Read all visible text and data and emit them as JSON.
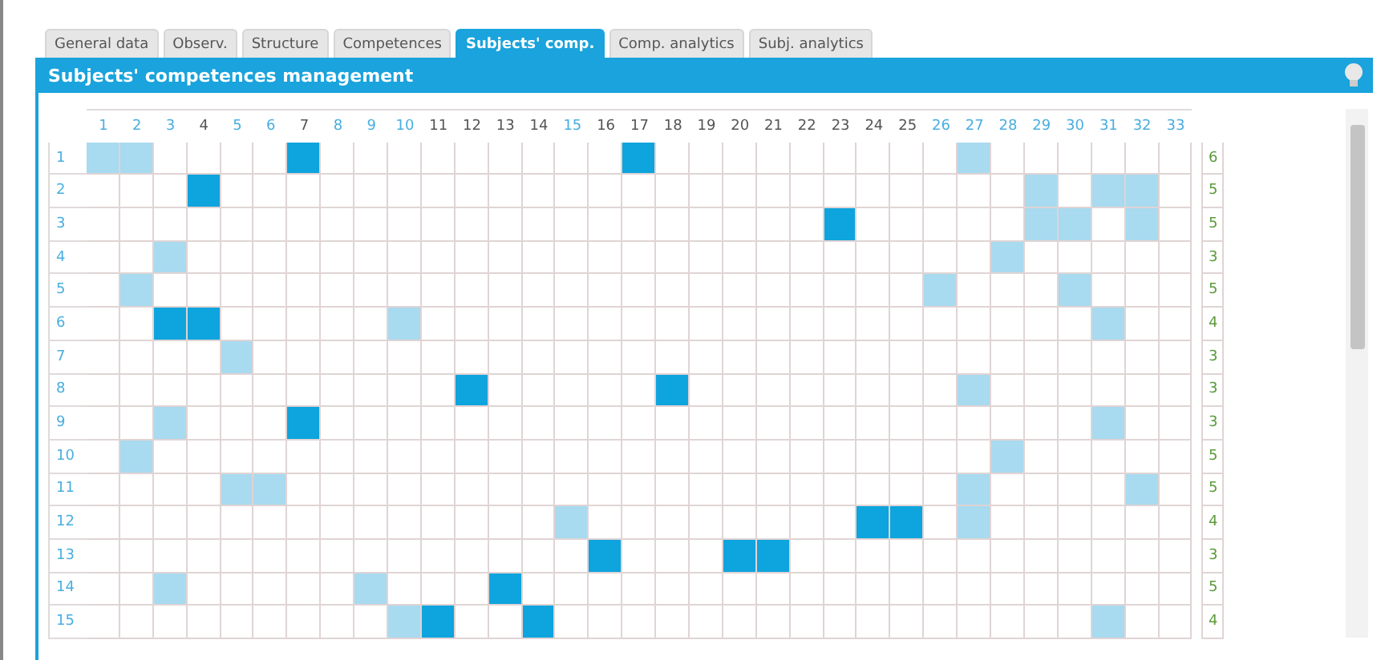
{
  "tabs": [
    {
      "label": "General data",
      "selected": false
    },
    {
      "label": "Observ.",
      "selected": false
    },
    {
      "label": "Structure",
      "selected": false
    },
    {
      "label": "Competences",
      "selected": false
    },
    {
      "label": "Subjects' comp.",
      "selected": true
    },
    {
      "label": "Comp. analytics",
      "selected": false
    },
    {
      "label": "Subj. analytics",
      "selected": false
    }
  ],
  "panel": {
    "title": "Subjects' competences management"
  },
  "columns": [
    {
      "label": "1",
      "highlighted": true
    },
    {
      "label": "2",
      "highlighted": true
    },
    {
      "label": "3",
      "highlighted": true
    },
    {
      "label": "4",
      "highlighted": false
    },
    {
      "label": "5",
      "highlighted": true
    },
    {
      "label": "6",
      "highlighted": true
    },
    {
      "label": "7",
      "highlighted": false
    },
    {
      "label": "8",
      "highlighted": true
    },
    {
      "label": "9",
      "highlighted": true
    },
    {
      "label": "10",
      "highlighted": true
    },
    {
      "label": "11",
      "highlighted": false
    },
    {
      "label": "12",
      "highlighted": false
    },
    {
      "label": "13",
      "highlighted": false
    },
    {
      "label": "14",
      "highlighted": false
    },
    {
      "label": "15",
      "highlighted": true
    },
    {
      "label": "16",
      "highlighted": false
    },
    {
      "label": "17",
      "highlighted": false
    },
    {
      "label": "18",
      "highlighted": false
    },
    {
      "label": "19",
      "highlighted": false
    },
    {
      "label": "20",
      "highlighted": false
    },
    {
      "label": "21",
      "highlighted": false
    },
    {
      "label": "22",
      "highlighted": false
    },
    {
      "label": "23",
      "highlighted": false
    },
    {
      "label": "24",
      "highlighted": false
    },
    {
      "label": "25",
      "highlighted": false
    },
    {
      "label": "26",
      "highlighted": true
    },
    {
      "label": "27",
      "highlighted": true
    },
    {
      "label": "28",
      "highlighted": true
    },
    {
      "label": "29",
      "highlighted": true
    },
    {
      "label": "30",
      "highlighted": true
    },
    {
      "label": "31",
      "highlighted": true
    },
    {
      "label": "32",
      "highlighted": true
    },
    {
      "label": "33",
      "highlighted": true
    }
  ],
  "rows": [
    {
      "label": "1",
      "count": "6",
      "cells": [
        {
          "kind": "light"
        },
        {
          "kind": "light"
        },
        {
          "kind": "none"
        },
        {
          "kind": "none"
        },
        {
          "kind": "none"
        },
        {
          "kind": "none"
        },
        {
          "kind": "dark"
        },
        {
          "kind": "none"
        },
        {
          "kind": "none"
        },
        {
          "kind": "none"
        },
        {
          "kind": "none"
        },
        {
          "kind": "none"
        },
        {
          "kind": "none"
        },
        {
          "kind": "none"
        },
        {
          "kind": "none"
        },
        {
          "kind": "none"
        },
        {
          "kind": "dark"
        },
        {
          "kind": "none"
        },
        {
          "kind": "none"
        },
        {
          "kind": "none"
        },
        {
          "kind": "none"
        },
        {
          "kind": "none"
        },
        {
          "kind": "none"
        },
        {
          "kind": "none"
        },
        {
          "kind": "none"
        },
        {
          "kind": "none"
        },
        {
          "kind": "light"
        },
        {
          "kind": "none"
        },
        {
          "kind": "none"
        },
        {
          "kind": "none"
        },
        {
          "kind": "none"
        },
        {
          "kind": "none"
        },
        {
          "kind": "none"
        }
      ]
    },
    {
      "label": "2",
      "count": "5",
      "cells": [
        {
          "kind": "none"
        },
        {
          "kind": "none"
        },
        {
          "kind": "none"
        },
        {
          "kind": "dark"
        },
        {
          "kind": "none"
        },
        {
          "kind": "none"
        },
        {
          "kind": "none"
        },
        {
          "kind": "none"
        },
        {
          "kind": "none"
        },
        {
          "kind": "none"
        },
        {
          "kind": "none"
        },
        {
          "kind": "none"
        },
        {
          "kind": "none"
        },
        {
          "kind": "none"
        },
        {
          "kind": "none"
        },
        {
          "kind": "none"
        },
        {
          "kind": "none"
        },
        {
          "kind": "none"
        },
        {
          "kind": "none"
        },
        {
          "kind": "none"
        },
        {
          "kind": "none"
        },
        {
          "kind": "none"
        },
        {
          "kind": "none"
        },
        {
          "kind": "none"
        },
        {
          "kind": "none"
        },
        {
          "kind": "none"
        },
        {
          "kind": "none"
        },
        {
          "kind": "none"
        },
        {
          "kind": "light"
        },
        {
          "kind": "none"
        },
        {
          "kind": "light"
        },
        {
          "kind": "light"
        },
        {
          "kind": "none"
        }
      ]
    },
    {
      "label": "3",
      "count": "5",
      "cells": [
        {
          "kind": "none"
        },
        {
          "kind": "none"
        },
        {
          "kind": "none"
        },
        {
          "kind": "none"
        },
        {
          "kind": "none"
        },
        {
          "kind": "none"
        },
        {
          "kind": "none"
        },
        {
          "kind": "none"
        },
        {
          "kind": "none"
        },
        {
          "kind": "none"
        },
        {
          "kind": "none"
        },
        {
          "kind": "none"
        },
        {
          "kind": "none"
        },
        {
          "kind": "none"
        },
        {
          "kind": "none"
        },
        {
          "kind": "none"
        },
        {
          "kind": "none"
        },
        {
          "kind": "none"
        },
        {
          "kind": "none"
        },
        {
          "kind": "none"
        },
        {
          "kind": "none"
        },
        {
          "kind": "none"
        },
        {
          "kind": "dark"
        },
        {
          "kind": "none"
        },
        {
          "kind": "none"
        },
        {
          "kind": "none"
        },
        {
          "kind": "none"
        },
        {
          "kind": "none"
        },
        {
          "kind": "light"
        },
        {
          "kind": "light"
        },
        {
          "kind": "none"
        },
        {
          "kind": "light"
        },
        {
          "kind": "none"
        }
      ]
    },
    {
      "label": "4",
      "count": "3",
      "cells": [
        {
          "kind": "none"
        },
        {
          "kind": "none"
        },
        {
          "kind": "light"
        },
        {
          "kind": "none"
        },
        {
          "kind": "none"
        },
        {
          "kind": "none"
        },
        {
          "kind": "none"
        },
        {
          "kind": "none"
        },
        {
          "kind": "none"
        },
        {
          "kind": "none"
        },
        {
          "kind": "none"
        },
        {
          "kind": "none"
        },
        {
          "kind": "none"
        },
        {
          "kind": "none"
        },
        {
          "kind": "none"
        },
        {
          "kind": "none"
        },
        {
          "kind": "none"
        },
        {
          "kind": "none"
        },
        {
          "kind": "none"
        },
        {
          "kind": "none"
        },
        {
          "kind": "none"
        },
        {
          "kind": "none"
        },
        {
          "kind": "none"
        },
        {
          "kind": "none"
        },
        {
          "kind": "none"
        },
        {
          "kind": "none"
        },
        {
          "kind": "none"
        },
        {
          "kind": "light"
        },
        {
          "kind": "none"
        },
        {
          "kind": "none"
        },
        {
          "kind": "none"
        },
        {
          "kind": "none"
        },
        {
          "kind": "none"
        }
      ]
    },
    {
      "label": "5",
      "count": "5",
      "cells": [
        {
          "kind": "none"
        },
        {
          "kind": "light"
        },
        {
          "kind": "none"
        },
        {
          "kind": "none"
        },
        {
          "kind": "none"
        },
        {
          "kind": "none"
        },
        {
          "kind": "none"
        },
        {
          "kind": "none"
        },
        {
          "kind": "none"
        },
        {
          "kind": "none"
        },
        {
          "kind": "none"
        },
        {
          "kind": "none"
        },
        {
          "kind": "none"
        },
        {
          "kind": "none"
        },
        {
          "kind": "none"
        },
        {
          "kind": "none"
        },
        {
          "kind": "none"
        },
        {
          "kind": "none"
        },
        {
          "kind": "none"
        },
        {
          "kind": "none"
        },
        {
          "kind": "none"
        },
        {
          "kind": "none"
        },
        {
          "kind": "none"
        },
        {
          "kind": "none"
        },
        {
          "kind": "none"
        },
        {
          "kind": "light"
        },
        {
          "kind": "none"
        },
        {
          "kind": "none"
        },
        {
          "kind": "none"
        },
        {
          "kind": "light"
        },
        {
          "kind": "none"
        },
        {
          "kind": "none"
        },
        {
          "kind": "none"
        }
      ]
    },
    {
      "label": "6",
      "count": "4",
      "cells": [
        {
          "kind": "none"
        },
        {
          "kind": "none"
        },
        {
          "kind": "dark"
        },
        {
          "kind": "dark"
        },
        {
          "kind": "none"
        },
        {
          "kind": "none"
        },
        {
          "kind": "none"
        },
        {
          "kind": "none"
        },
        {
          "kind": "none"
        },
        {
          "kind": "light"
        },
        {
          "kind": "none"
        },
        {
          "kind": "none"
        },
        {
          "kind": "none"
        },
        {
          "kind": "none"
        },
        {
          "kind": "none"
        },
        {
          "kind": "none"
        },
        {
          "kind": "none"
        },
        {
          "kind": "none"
        },
        {
          "kind": "none"
        },
        {
          "kind": "none"
        },
        {
          "kind": "none"
        },
        {
          "kind": "none"
        },
        {
          "kind": "none"
        },
        {
          "kind": "none"
        },
        {
          "kind": "none"
        },
        {
          "kind": "none"
        },
        {
          "kind": "none"
        },
        {
          "kind": "none"
        },
        {
          "kind": "none"
        },
        {
          "kind": "none"
        },
        {
          "kind": "light"
        },
        {
          "kind": "none"
        },
        {
          "kind": "none"
        }
      ]
    },
    {
      "label": "7",
      "count": "3",
      "cells": [
        {
          "kind": "none"
        },
        {
          "kind": "none"
        },
        {
          "kind": "none"
        },
        {
          "kind": "none"
        },
        {
          "kind": "light"
        },
        {
          "kind": "none"
        },
        {
          "kind": "none"
        },
        {
          "kind": "none"
        },
        {
          "kind": "none"
        },
        {
          "kind": "none"
        },
        {
          "kind": "none"
        },
        {
          "kind": "none"
        },
        {
          "kind": "none"
        },
        {
          "kind": "none"
        },
        {
          "kind": "none"
        },
        {
          "kind": "none"
        },
        {
          "kind": "none"
        },
        {
          "kind": "none"
        },
        {
          "kind": "none"
        },
        {
          "kind": "none"
        },
        {
          "kind": "none"
        },
        {
          "kind": "none"
        },
        {
          "kind": "none"
        },
        {
          "kind": "none"
        },
        {
          "kind": "none"
        },
        {
          "kind": "none"
        },
        {
          "kind": "none"
        },
        {
          "kind": "none"
        },
        {
          "kind": "none"
        },
        {
          "kind": "none"
        },
        {
          "kind": "none"
        },
        {
          "kind": "none"
        },
        {
          "kind": "none"
        }
      ]
    },
    {
      "label": "8",
      "count": "3",
      "cells": [
        {
          "kind": "none"
        },
        {
          "kind": "none"
        },
        {
          "kind": "none"
        },
        {
          "kind": "none"
        },
        {
          "kind": "none"
        },
        {
          "kind": "none"
        },
        {
          "kind": "none"
        },
        {
          "kind": "none"
        },
        {
          "kind": "none"
        },
        {
          "kind": "none"
        },
        {
          "kind": "none"
        },
        {
          "kind": "dark"
        },
        {
          "kind": "none"
        },
        {
          "kind": "none"
        },
        {
          "kind": "none"
        },
        {
          "kind": "none"
        },
        {
          "kind": "none"
        },
        {
          "kind": "dark"
        },
        {
          "kind": "none"
        },
        {
          "kind": "none"
        },
        {
          "kind": "none"
        },
        {
          "kind": "none"
        },
        {
          "kind": "none"
        },
        {
          "kind": "none"
        },
        {
          "kind": "none"
        },
        {
          "kind": "none"
        },
        {
          "kind": "light"
        },
        {
          "kind": "none"
        },
        {
          "kind": "none"
        },
        {
          "kind": "none"
        },
        {
          "kind": "none"
        },
        {
          "kind": "none"
        },
        {
          "kind": "none"
        }
      ]
    },
    {
      "label": "9",
      "count": "3",
      "cells": [
        {
          "kind": "none"
        },
        {
          "kind": "none"
        },
        {
          "kind": "light"
        },
        {
          "kind": "none"
        },
        {
          "kind": "none"
        },
        {
          "kind": "none"
        },
        {
          "kind": "dark"
        },
        {
          "kind": "none"
        },
        {
          "kind": "none"
        },
        {
          "kind": "none"
        },
        {
          "kind": "none"
        },
        {
          "kind": "none"
        },
        {
          "kind": "none"
        },
        {
          "kind": "none"
        },
        {
          "kind": "none"
        },
        {
          "kind": "none"
        },
        {
          "kind": "none"
        },
        {
          "kind": "none"
        },
        {
          "kind": "none"
        },
        {
          "kind": "none"
        },
        {
          "kind": "none"
        },
        {
          "kind": "none"
        },
        {
          "kind": "none"
        },
        {
          "kind": "none"
        },
        {
          "kind": "none"
        },
        {
          "kind": "none"
        },
        {
          "kind": "none"
        },
        {
          "kind": "none"
        },
        {
          "kind": "none"
        },
        {
          "kind": "none"
        },
        {
          "kind": "light"
        },
        {
          "kind": "none"
        },
        {
          "kind": "none"
        }
      ]
    },
    {
      "label": "10",
      "count": "5",
      "cells": [
        {
          "kind": "none"
        },
        {
          "kind": "light"
        },
        {
          "kind": "none"
        },
        {
          "kind": "none"
        },
        {
          "kind": "none"
        },
        {
          "kind": "none"
        },
        {
          "kind": "none"
        },
        {
          "kind": "none"
        },
        {
          "kind": "none"
        },
        {
          "kind": "none"
        },
        {
          "kind": "none"
        },
        {
          "kind": "none"
        },
        {
          "kind": "none"
        },
        {
          "kind": "none"
        },
        {
          "kind": "none"
        },
        {
          "kind": "none"
        },
        {
          "kind": "none"
        },
        {
          "kind": "none"
        },
        {
          "kind": "none"
        },
        {
          "kind": "none"
        },
        {
          "kind": "none"
        },
        {
          "kind": "none"
        },
        {
          "kind": "none"
        },
        {
          "kind": "none"
        },
        {
          "kind": "none"
        },
        {
          "kind": "none"
        },
        {
          "kind": "none"
        },
        {
          "kind": "light"
        },
        {
          "kind": "none"
        },
        {
          "kind": "none"
        },
        {
          "kind": "none"
        },
        {
          "kind": "none"
        },
        {
          "kind": "none"
        }
      ]
    },
    {
      "label": "11",
      "count": "5",
      "cells": [
        {
          "kind": "none"
        },
        {
          "kind": "none"
        },
        {
          "kind": "none"
        },
        {
          "kind": "none"
        },
        {
          "kind": "light"
        },
        {
          "kind": "light"
        },
        {
          "kind": "none"
        },
        {
          "kind": "none"
        },
        {
          "kind": "none"
        },
        {
          "kind": "none"
        },
        {
          "kind": "none"
        },
        {
          "kind": "none"
        },
        {
          "kind": "none"
        },
        {
          "kind": "none"
        },
        {
          "kind": "none"
        },
        {
          "kind": "none"
        },
        {
          "kind": "none"
        },
        {
          "kind": "none"
        },
        {
          "kind": "none"
        },
        {
          "kind": "none"
        },
        {
          "kind": "none"
        },
        {
          "kind": "none"
        },
        {
          "kind": "none"
        },
        {
          "kind": "none"
        },
        {
          "kind": "none"
        },
        {
          "kind": "none"
        },
        {
          "kind": "light"
        },
        {
          "kind": "none"
        },
        {
          "kind": "none"
        },
        {
          "kind": "none"
        },
        {
          "kind": "none"
        },
        {
          "kind": "light"
        },
        {
          "kind": "none"
        }
      ]
    },
    {
      "label": "12",
      "count": "4",
      "cells": [
        {
          "kind": "none"
        },
        {
          "kind": "none"
        },
        {
          "kind": "none"
        },
        {
          "kind": "none"
        },
        {
          "kind": "none"
        },
        {
          "kind": "none"
        },
        {
          "kind": "none"
        },
        {
          "kind": "none"
        },
        {
          "kind": "none"
        },
        {
          "kind": "none"
        },
        {
          "kind": "none"
        },
        {
          "kind": "none"
        },
        {
          "kind": "none"
        },
        {
          "kind": "none"
        },
        {
          "kind": "light"
        },
        {
          "kind": "none"
        },
        {
          "kind": "none"
        },
        {
          "kind": "none"
        },
        {
          "kind": "none"
        },
        {
          "kind": "none"
        },
        {
          "kind": "none"
        },
        {
          "kind": "none"
        },
        {
          "kind": "none"
        },
        {
          "kind": "dark"
        },
        {
          "kind": "dark"
        },
        {
          "kind": "none"
        },
        {
          "kind": "light"
        },
        {
          "kind": "none"
        },
        {
          "kind": "none"
        },
        {
          "kind": "none"
        },
        {
          "kind": "none"
        },
        {
          "kind": "none"
        },
        {
          "kind": "none"
        }
      ]
    },
    {
      "label": "13",
      "count": "3",
      "cells": [
        {
          "kind": "none"
        },
        {
          "kind": "none"
        },
        {
          "kind": "none"
        },
        {
          "kind": "none"
        },
        {
          "kind": "none"
        },
        {
          "kind": "none"
        },
        {
          "kind": "none"
        },
        {
          "kind": "none"
        },
        {
          "kind": "none"
        },
        {
          "kind": "none"
        },
        {
          "kind": "none"
        },
        {
          "kind": "none"
        },
        {
          "kind": "none"
        },
        {
          "kind": "none"
        },
        {
          "kind": "none"
        },
        {
          "kind": "dark"
        },
        {
          "kind": "none"
        },
        {
          "kind": "none"
        },
        {
          "kind": "none"
        },
        {
          "kind": "dark"
        },
        {
          "kind": "dark"
        },
        {
          "kind": "none"
        },
        {
          "kind": "none"
        },
        {
          "kind": "none"
        },
        {
          "kind": "none"
        },
        {
          "kind": "none"
        },
        {
          "kind": "none"
        },
        {
          "kind": "none"
        },
        {
          "kind": "none"
        },
        {
          "kind": "none"
        },
        {
          "kind": "none"
        },
        {
          "kind": "none"
        },
        {
          "kind": "none"
        }
      ]
    },
    {
      "label": "14",
      "count": "5",
      "cells": [
        {
          "kind": "none"
        },
        {
          "kind": "none"
        },
        {
          "kind": "light"
        },
        {
          "kind": "none"
        },
        {
          "kind": "none"
        },
        {
          "kind": "none"
        },
        {
          "kind": "none"
        },
        {
          "kind": "none"
        },
        {
          "kind": "light"
        },
        {
          "kind": "none"
        },
        {
          "kind": "none"
        },
        {
          "kind": "none"
        },
        {
          "kind": "dark"
        },
        {
          "kind": "none"
        },
        {
          "kind": "none"
        },
        {
          "kind": "none"
        },
        {
          "kind": "none"
        },
        {
          "kind": "none"
        },
        {
          "kind": "none"
        },
        {
          "kind": "none"
        },
        {
          "kind": "none"
        },
        {
          "kind": "none"
        },
        {
          "kind": "none"
        },
        {
          "kind": "none"
        },
        {
          "kind": "none"
        },
        {
          "kind": "none"
        },
        {
          "kind": "none"
        },
        {
          "kind": "none"
        },
        {
          "kind": "none"
        },
        {
          "kind": "none"
        },
        {
          "kind": "none"
        },
        {
          "kind": "none"
        },
        {
          "kind": "none"
        }
      ]
    },
    {
      "label": "15",
      "count": "4",
      "cells": [
        {
          "kind": "none"
        },
        {
          "kind": "none"
        },
        {
          "kind": "none"
        },
        {
          "kind": "none"
        },
        {
          "kind": "none"
        },
        {
          "kind": "none"
        },
        {
          "kind": "none"
        },
        {
          "kind": "none"
        },
        {
          "kind": "none"
        },
        {
          "kind": "light"
        },
        {
          "kind": "dark"
        },
        {
          "kind": "none"
        },
        {
          "kind": "none"
        },
        {
          "kind": "dark"
        },
        {
          "kind": "none"
        },
        {
          "kind": "none"
        },
        {
          "kind": "none"
        },
        {
          "kind": "none"
        },
        {
          "kind": "none"
        },
        {
          "kind": "none"
        },
        {
          "kind": "none"
        },
        {
          "kind": "none"
        },
        {
          "kind": "none"
        },
        {
          "kind": "none"
        },
        {
          "kind": "none"
        },
        {
          "kind": "none"
        },
        {
          "kind": "none"
        },
        {
          "kind": "none"
        },
        {
          "kind": "none"
        },
        {
          "kind": "none"
        },
        {
          "kind": "light"
        },
        {
          "kind": "none"
        },
        {
          "kind": "none"
        }
      ]
    }
  ]
}
